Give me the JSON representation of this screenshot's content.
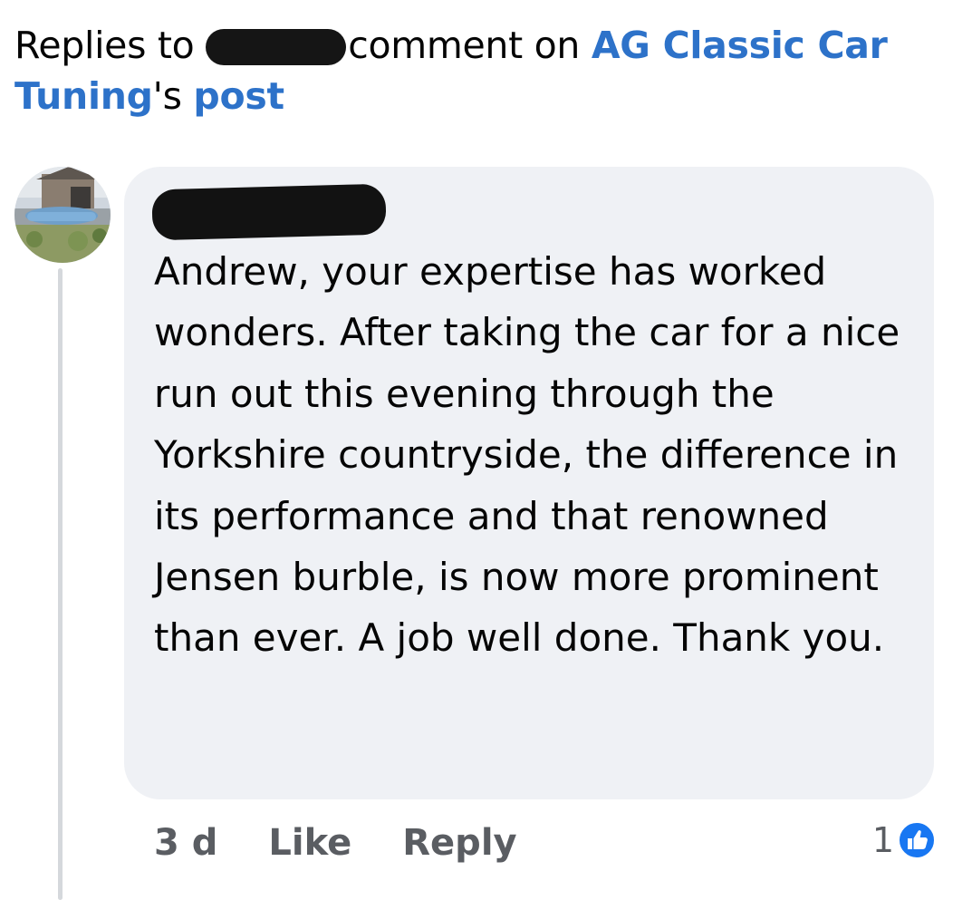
{
  "header": {
    "prefix": "Replies to",
    "suffix": "comment on",
    "page_name_line1": "AG Classic Car",
    "page_name_line2": "Tuning",
    "possessive": "'s",
    "post_link": "post"
  },
  "comment": {
    "text": "Andrew, your expertise has worked wonders. After taking the car for a nice run out this evening through the Yorkshire countryside, the difference in its performance and that renowned Jensen burble, is now more prominent than ever. A job well done. Thank you.",
    "time": "3 d",
    "like_label": "Like",
    "reply_label": "Reply",
    "reaction_count": "1",
    "reaction_icon": "thumbs-up-icon"
  },
  "colors": {
    "link": "#2d72c9",
    "bubble": "#eff1f5",
    "meta_text": "#5a5d62",
    "like_blue": "#1877f2"
  }
}
